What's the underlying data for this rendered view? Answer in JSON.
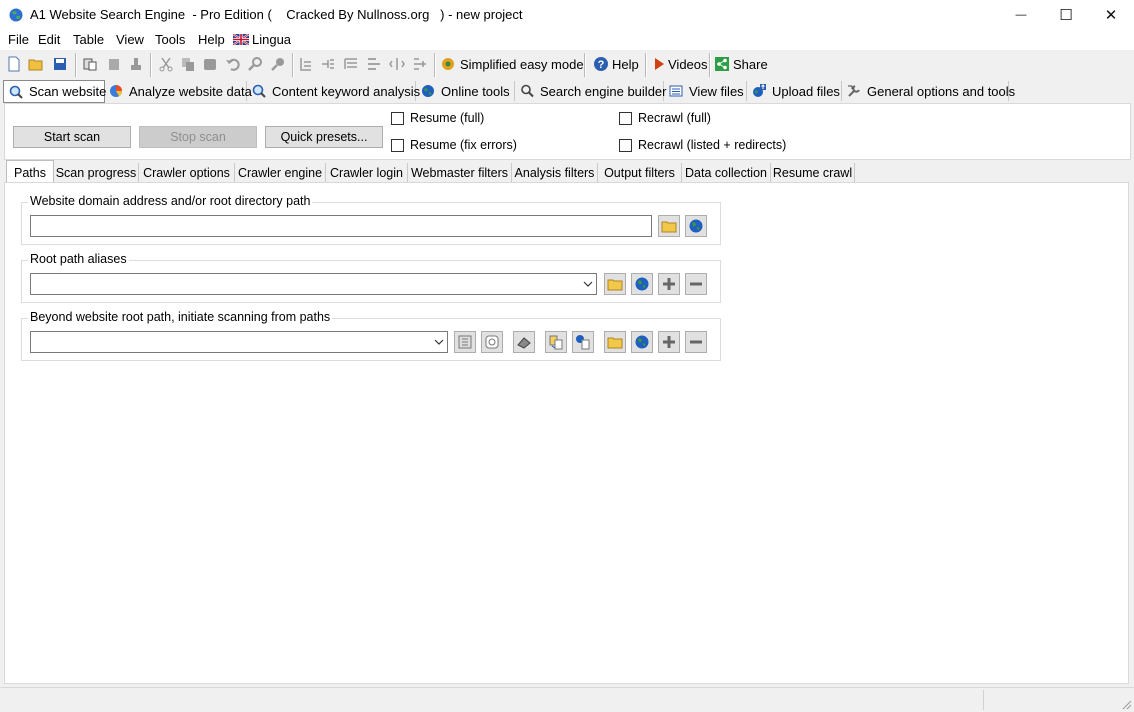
{
  "window": {
    "title": "A1 Website Search Engine  - Pro Edition (    Cracked By Nullnoss.org   ) - new project",
    "minimize_glyph": "—",
    "maximize_glyph": "☐",
    "close_glyph": "✕"
  },
  "menu": {
    "items": [
      "File",
      "Edit",
      "Table",
      "View",
      "Tools",
      "Help",
      "Lingua"
    ]
  },
  "toolbar": {
    "simplified_mode": "Simplified easy mode",
    "help": "Help",
    "videos": "Videos",
    "share": "Share"
  },
  "main_tabs": [
    {
      "label": "Scan website",
      "icon": "magnifier-icon"
    },
    {
      "label": "Analyze website data",
      "icon": "pie-chart-icon"
    },
    {
      "label": "Content keyword analysis",
      "icon": "magnifier-icon"
    },
    {
      "label": "Online tools",
      "icon": "globe-icon"
    },
    {
      "label": "Search engine builder",
      "icon": "search-icon"
    },
    {
      "label": "View files",
      "icon": "list-icon"
    },
    {
      "label": "Upload files",
      "icon": "upload-globe-icon"
    },
    {
      "label": "General options and tools",
      "icon": "tools-icon"
    }
  ],
  "scan_controls": {
    "start_scan": "Start scan",
    "stop_scan": "Stop scan",
    "quick_presets": "Quick presets...",
    "resume_full": "Resume (full)",
    "resume_fix_errors": "Resume (fix errors)",
    "recrawl_full": "Recrawl (full)",
    "recrawl_listed": "Recrawl (listed + redirects)"
  },
  "sub_tabs": [
    "Paths",
    "Scan progress",
    "Crawler options",
    "Crawler engine",
    "Crawler login",
    "Webmaster filters",
    "Analysis filters",
    "Output filters",
    "Data collection",
    "Resume crawl"
  ],
  "paths": {
    "root_path_label": "Website domain address and/or root directory path",
    "root_path_value": "",
    "aliases_label": "Root path aliases",
    "aliases_value": "",
    "beyond_label": "Beyond website root path, initiate scanning from paths",
    "beyond_value": ""
  },
  "colors": {
    "folder": "#e8b923",
    "globe_blue": "#1f5fbf",
    "globe_green": "#3a9a3a",
    "button_face": "#e1e1e1"
  }
}
